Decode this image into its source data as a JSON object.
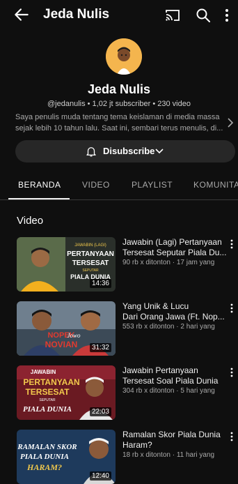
{
  "header": {
    "title": "Jeda Nulis"
  },
  "channel": {
    "name": "Jeda Nulis",
    "meta": "@jedanulis • 1,02 jt subscriber • 230 video",
    "description_lines": [
      "Saya penulis muda tentang tema keislaman di media massa",
      "sejak lebih 10 tahun lalu. Saat ini, sembari terus menulis, di..."
    ]
  },
  "subscribe_button": {
    "label": "Disubscribe"
  },
  "tabs": [
    {
      "label": "BERANDA"
    },
    {
      "label": "VIDEO"
    },
    {
      "label": "PLAYLIST"
    },
    {
      "label": "KOMUNITAS"
    }
  ],
  "section": {
    "title": "Video"
  },
  "videos": [
    {
      "title_lines": [
        "Jawabin (Lagi) Pertanyaan",
        "Tersesat Seputar Piala Du..."
      ],
      "meta": "90 rb x ditonton · 17 jam yang",
      "duration": "14:36",
      "thumb_text": {
        "top": "JAWABIN (LAGI)",
        "l1": "PERTANYAAN",
        "l2": "TERSESAT",
        "l3": "SEPUTAR",
        "l4": "PIALA DUNIA"
      }
    },
    {
      "title_lines": [
        "Yang Unik & Lucu",
        "Dari Orang Jawa (Ft. Nop..."
      ],
      "meta": "553 rb x ditonton · 2 hari yang",
      "duration": "31:32",
      "thumb_text": {
        "l1": "NOPEK",
        "l2": "NOVIAN",
        "l3": "Jowo"
      }
    },
    {
      "title_lines": [
        "Jawabin Pertanyaan",
        "Tersesat Soal Piala Dunia"
      ],
      "meta": "304 rb x ditonton · 5 hari yang",
      "duration": "22:03",
      "thumb_text": {
        "top": "JAWABIN",
        "l1": "PERTANYAAN",
        "l2": "TERSESAT",
        "l3": "SEPUTAR",
        "l4": "PIALA DUNIA"
      }
    },
    {
      "title_lines": [
        "Ramalan Skor Piala Dunia",
        "Haram?"
      ],
      "meta": "18 rb x ditonton · 11 hari yang",
      "duration": "12:40",
      "thumb_text": {
        "l1": "RAMALAN SKOR",
        "l2": "PIALA DUNIA",
        "l3": "HARAM?"
      }
    }
  ]
}
